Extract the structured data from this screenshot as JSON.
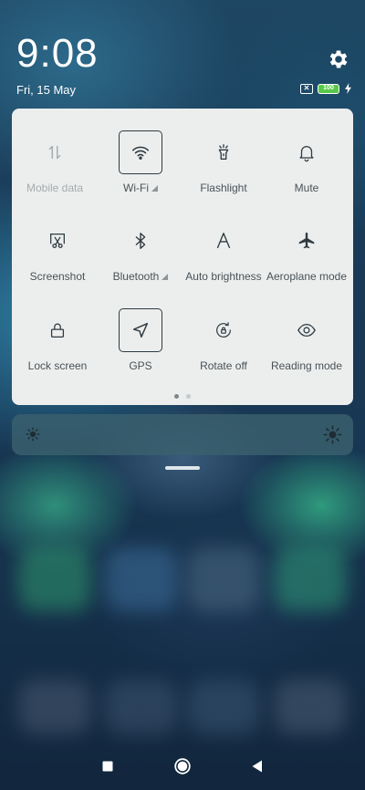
{
  "status": {
    "time": "9:08",
    "date": "Fri, 15 May",
    "sim_glyph": "✕",
    "battery_level": "100",
    "icons": [
      "sim-off-icon",
      "battery-icon",
      "charging-bolt-icon",
      "settings-gear-icon"
    ]
  },
  "quick_settings": {
    "tiles": [
      {
        "label": "Mobile data",
        "icon": "mobile-data-arrows-icon",
        "active": false,
        "disabled": true,
        "has_arrow": false
      },
      {
        "label": "Wi-Fi",
        "icon": "wifi-icon",
        "active": true,
        "disabled": false,
        "has_arrow": true
      },
      {
        "label": "Flashlight",
        "icon": "flashlight-icon",
        "active": false,
        "disabled": false,
        "has_arrow": false
      },
      {
        "label": "Mute",
        "icon": "bell-icon",
        "active": false,
        "disabled": false,
        "has_arrow": false
      },
      {
        "label": "Screenshot",
        "icon": "scissors-screenshot-icon",
        "active": false,
        "disabled": false,
        "has_arrow": false
      },
      {
        "label": "Bluetooth",
        "icon": "bluetooth-icon",
        "active": false,
        "disabled": false,
        "has_arrow": true
      },
      {
        "label": "Auto brightness",
        "icon": "auto-brightness-a-icon",
        "active": false,
        "disabled": false,
        "has_arrow": false
      },
      {
        "label": "Aeroplane mode",
        "icon": "airplane-icon",
        "active": false,
        "disabled": false,
        "has_arrow": false
      },
      {
        "label": "Lock screen",
        "icon": "lock-icon",
        "active": false,
        "disabled": false,
        "has_arrow": false
      },
      {
        "label": "GPS",
        "icon": "location-arrow-icon",
        "active": true,
        "disabled": false,
        "has_arrow": false
      },
      {
        "label": "Rotate off",
        "icon": "rotate-lock-icon",
        "active": false,
        "disabled": false,
        "has_arrow": false
      },
      {
        "label": "Reading mode",
        "icon": "eye-icon",
        "active": false,
        "disabled": false,
        "has_arrow": false
      }
    ],
    "page_count": 2,
    "current_page": 1
  },
  "brightness": {
    "left_icon": "brightness-low-icon",
    "right_icon": "brightness-high-icon"
  },
  "navbar": {
    "buttons": [
      "recents-square-icon",
      "home-circle-icon",
      "back-triangle-icon"
    ]
  },
  "colors": {
    "panel_bg": "#eceeee",
    "icon_color": "#2f3b40",
    "battery_fill": "#58c84a"
  }
}
